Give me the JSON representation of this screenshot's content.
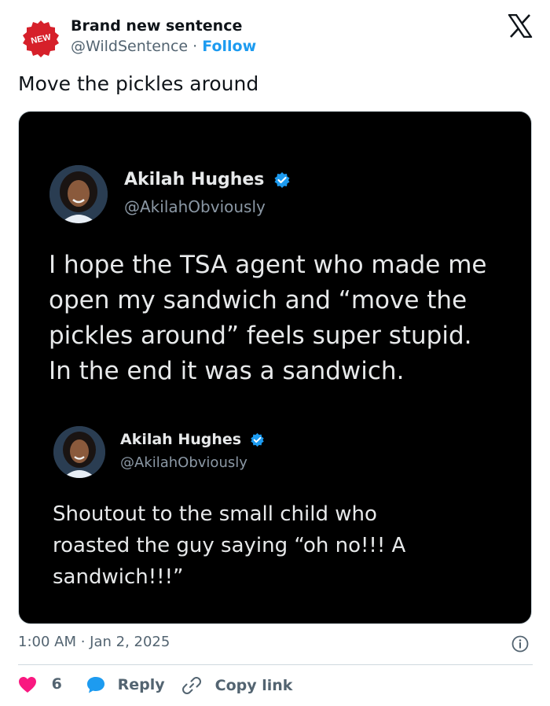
{
  "author": {
    "badge_text": "NEW",
    "name": "Brand new sentence",
    "handle": "@WildSentence",
    "separator": "·",
    "follow_label": "Follow"
  },
  "tweet": {
    "text": "Move the pickles around",
    "timestamp": "1:00 AM · Jan 2, 2025"
  },
  "embedded_tweets": [
    {
      "name": "Akilah Hughes",
      "handle": "@AkilahObviously",
      "lines": [
        "I hope the TSA agent who made me",
        "open my sandwich and “move the",
        "pickles around” feels super stupid.",
        "In the end it was a sandwich."
      ]
    },
    {
      "name": "Akilah Hughes",
      "handle": "@AkilahObviously",
      "lines": [
        "Shoutout to the small child who",
        "roasted the guy saying “oh no!!! A",
        "sandwich!!!”"
      ]
    }
  ],
  "actions": {
    "like_count": "6",
    "reply_label": "Reply",
    "copy_label": "Copy link"
  },
  "colors": {
    "accent": "#1d9bf0",
    "like": "#f91880",
    "badge": "#d6202a"
  },
  "icons": [
    "new-badge-icon",
    "x-logo-icon",
    "verified-icon",
    "info-icon",
    "heart-icon",
    "reply-bubble-icon",
    "link-icon"
  ]
}
